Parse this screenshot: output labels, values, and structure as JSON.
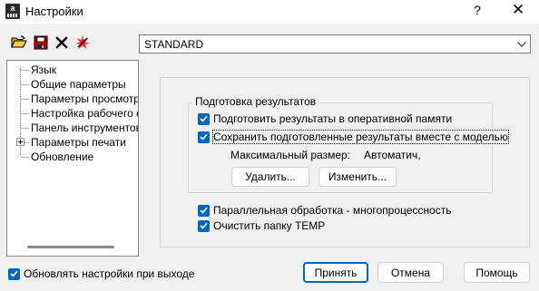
{
  "window": {
    "title": "Настройки",
    "app_icon_letter": "a",
    "help_glyph": "?",
    "close_glyph": "✕"
  },
  "toolbar": {
    "icons": [
      "open-folder-icon",
      "save-disk-icon",
      "delete-x-icon",
      "reset-star-icon"
    ]
  },
  "profile_combo": {
    "value": "STANDARD"
  },
  "tree": {
    "items": [
      {
        "label": "Язык"
      },
      {
        "label": "Общие параметры"
      },
      {
        "label": "Параметры просмотра"
      },
      {
        "label": "Настройка рабочего ст"
      },
      {
        "label": "Панель инструментов и"
      },
      {
        "label": "Параметры печати",
        "expandable": true
      },
      {
        "label": "Обновление"
      }
    ]
  },
  "results_group": {
    "title": "Подготовка результатов",
    "prepare_in_memory": {
      "label": "Подготовить результаты в оперативной памяти",
      "checked": true
    },
    "save_with_model": {
      "label": "Сохранить подготовленные результаты вместе с моделью",
      "checked": true
    },
    "max_size_label": "Максимальный размер:",
    "max_size_value": "Автоматич,",
    "delete_button": "Удалить...",
    "change_button": "Изменить..."
  },
  "parallel_processing": {
    "label": "Параллельная обработка - многопроцессность",
    "checked": true
  },
  "clear_temp": {
    "label": "Очистить папку TEMP",
    "checked": true
  },
  "update_on_exit": {
    "label": "Обновлять настройки при выходе",
    "checked": true
  },
  "buttons": {
    "accept": "Принять",
    "cancel": "Отмена",
    "help": "Помощь"
  },
  "colors": {
    "accent": "#0067c0",
    "window_bg": "#f0f0f0",
    "title_bg": "#ffffff"
  }
}
